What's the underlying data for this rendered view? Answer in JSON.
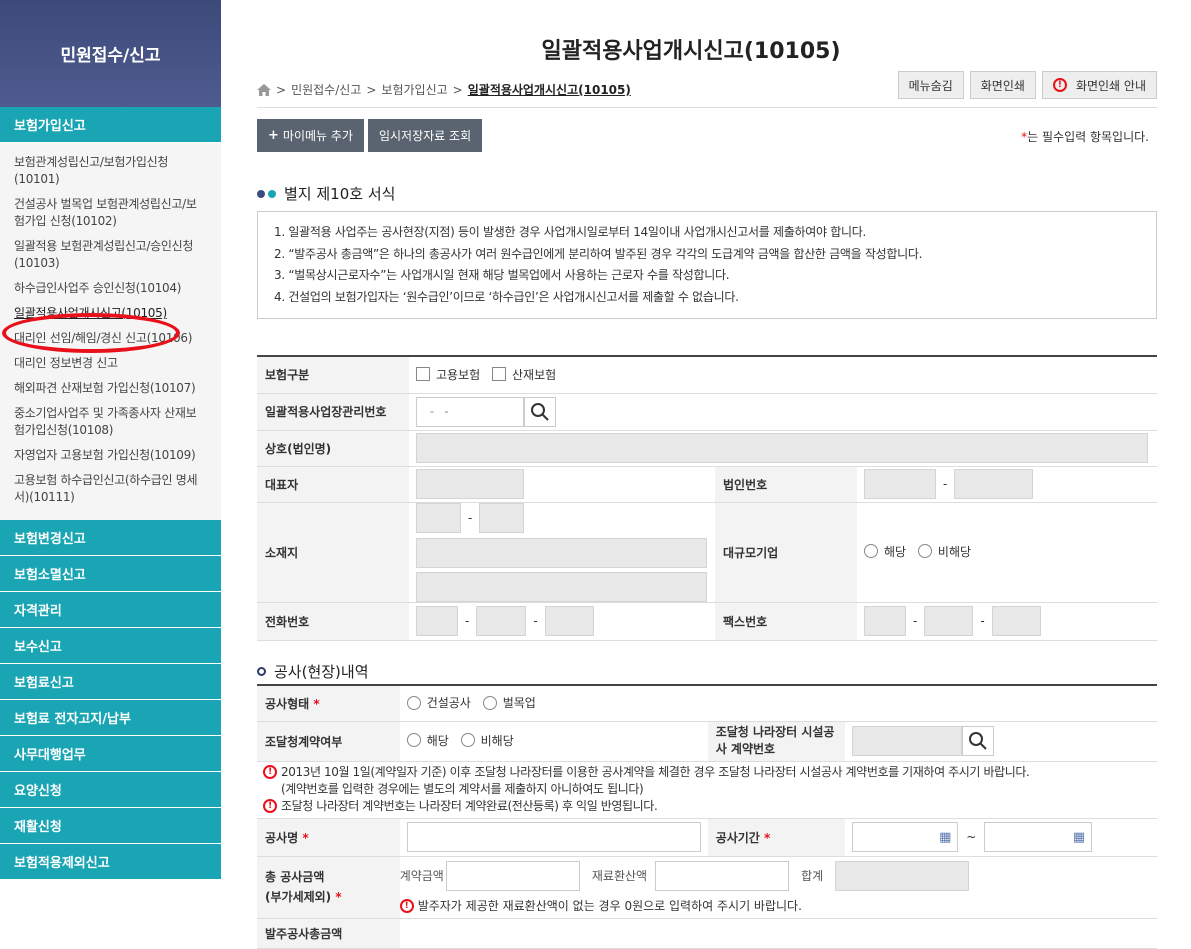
{
  "sidebar": {
    "header": "민원접수/신고",
    "category_top": "보험가입신고",
    "sub_items": [
      "보험관계성립신고/보험가입신청(10101)",
      "건설공사 벌목업 보험관계성립신고/보험가입 신청(10102)",
      "일괄적용 보험관계성립신고/승인신청(10103)",
      "하수급인사업주 승인신청(10104)",
      "일괄적용사업개시신고(10105)",
      "대리인 선임/해임/경신 신고(10106)",
      "대리인 정보변경 신고",
      "해외파견 산재보험 가입신청(10107)",
      "중소기업사업주 및 가족종사자 산재보험가입신청(10108)",
      "자영업자 고용보험 가입신청(10109)",
      "고용보험 하수급인신고(하수급인 명세서)(10111)"
    ],
    "categories": [
      "보험변경신고",
      "보험소멸신고",
      "자격관리",
      "보수신고",
      "보험료신고",
      "보험료 전자고지/납부",
      "사무대행업무",
      "요양신청",
      "재활신청",
      "보험적용제외신고"
    ]
  },
  "page": {
    "title": "일괄적용사업개시신고(10105)",
    "breadcrumb": [
      "민원접수/신고",
      "보험가입신고",
      "일괄적용사업개시신고(10105)"
    ],
    "menu_hide": "메뉴숨김",
    "print": "화면인쇄",
    "print_guide": "화면인쇄 안내",
    "add_mymenu": "마이메뉴 추가",
    "temp_load": "임시저장자료 조회",
    "req_star": "*",
    "req_note": "는 필수입력 항목입니다."
  },
  "form_section": {
    "title": "별지 제10호 서식",
    "notices": [
      "1. 일괄적용 사업주는 공사현장(지점) 등이 발생한 경우 사업개시일로부터 14일이내 사업개시신고서를 제출하여야 합니다.",
      "2. “발주공사 총금액”은 하나의 총공사가 여러 원수급인에게 분리하여 발주된 경우 각각의 도급계약 금액을 합산한 금액을 작성합니다.",
      "3. “벌목상시근로자수”는 사업개시일 현재 해당 벌목업에서 사용하는 근로자 수를 작성합니다.",
      "4. 건설업의 보험가입자는 ‘원수급인’이므로 ‘하수급인’은 사업개시신고서를 제출할 수 없습니다."
    ]
  },
  "table1": {
    "insurance_type": "보험구분",
    "employment": "고용보험",
    "industrial": "산재보험",
    "mgmt_no": "일괄적용사업장관리번호",
    "mgmt_placeholder": "  -   -",
    "company": "상호(법인명)",
    "ceo": "대표자",
    "corp_no": "법인번호",
    "address": "소재지",
    "large_corp": "대규모기업",
    "yes": "해당",
    "no": "비해당",
    "phone": "전화번호",
    "fax": "팩스번호"
  },
  "work_section": {
    "title": "공사(현장)내역",
    "work_type": "공사형태",
    "construction": "건설공사",
    "logging": "벌목업",
    "procurement": "조달청계약여부",
    "yes": "해당",
    "no": "비해당",
    "nara_label": "조달청 나라장터 시설공사 계약번호",
    "warn1": "2013년 10월 1일(계약일자 기준) 이후 조달청 나라장터를 이용한 공사계약을 체결한 경우 조달청 나라장터 시설공사  계약번호를 기재하여 주시기 바랍니다.",
    "warn1b": "(계약번호를 입력한 경우에는 별도의 계약서를 제출하지 아니하여도 됩니다)",
    "warn2": "조달청 나라장터 계약번호는 나라장터 계약완료(전산등록) 후 익일 반영됩니다.",
    "work_name": "공사명",
    "period": "공사기간",
    "tilde": "~",
    "total_line1": "총 공사금액",
    "total_line2": "(부가세제외)",
    "contract_amt": "계약금액",
    "material_amt": "재료환산액",
    "sum": "합계",
    "warn3": "발주자가 제공한 재료환산액이 없는 경우 0원으로 입력하여 주시기 바랍니다.",
    "order_total": "발주공사총금액"
  }
}
